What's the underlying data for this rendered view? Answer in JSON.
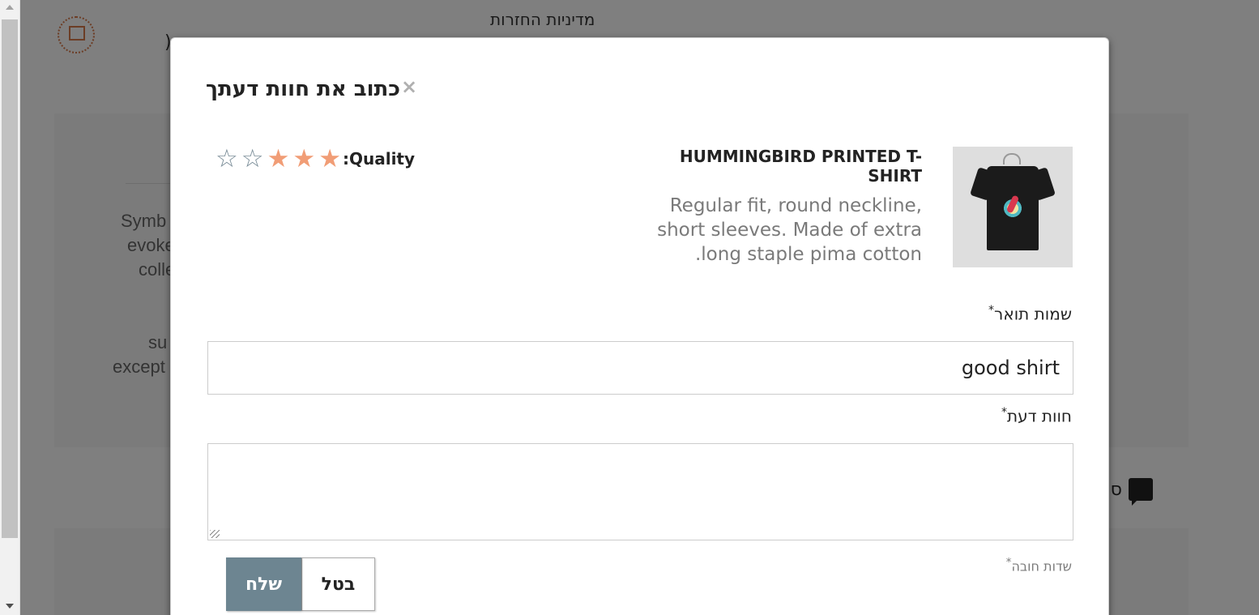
{
  "background": {
    "section_title": "מדיניות החזרות",
    "paren": ")",
    "text_lines": [
      "Symb",
      "evoke",
      "colle",
      "su",
      "except"
    ],
    "reviews_label": "סק"
  },
  "modal": {
    "title": "כתוב את חוות דעתך",
    "close_symbol": "×",
    "product": {
      "name": "HUMMINGBIRD PRINTED T-SHIRT",
      "description": "Regular fit, round neckline, short sleeves. Made of extra long staple pima cotton."
    },
    "rating": {
      "label": ":Quality",
      "value": 3,
      "max": 5,
      "full_color": "#f19d76",
      "empty_color": "#7a8d98"
    },
    "title_field": {
      "label": "שמות תואר",
      "required_mark": "*",
      "value": "good shirt"
    },
    "review_field": {
      "label": "חוות דעת",
      "required_mark": "*",
      "value": ""
    },
    "required_note": "שדות חובה",
    "required_note_mark": "*",
    "buttons": {
      "cancel": "בטל",
      "submit": "שלח"
    }
  }
}
